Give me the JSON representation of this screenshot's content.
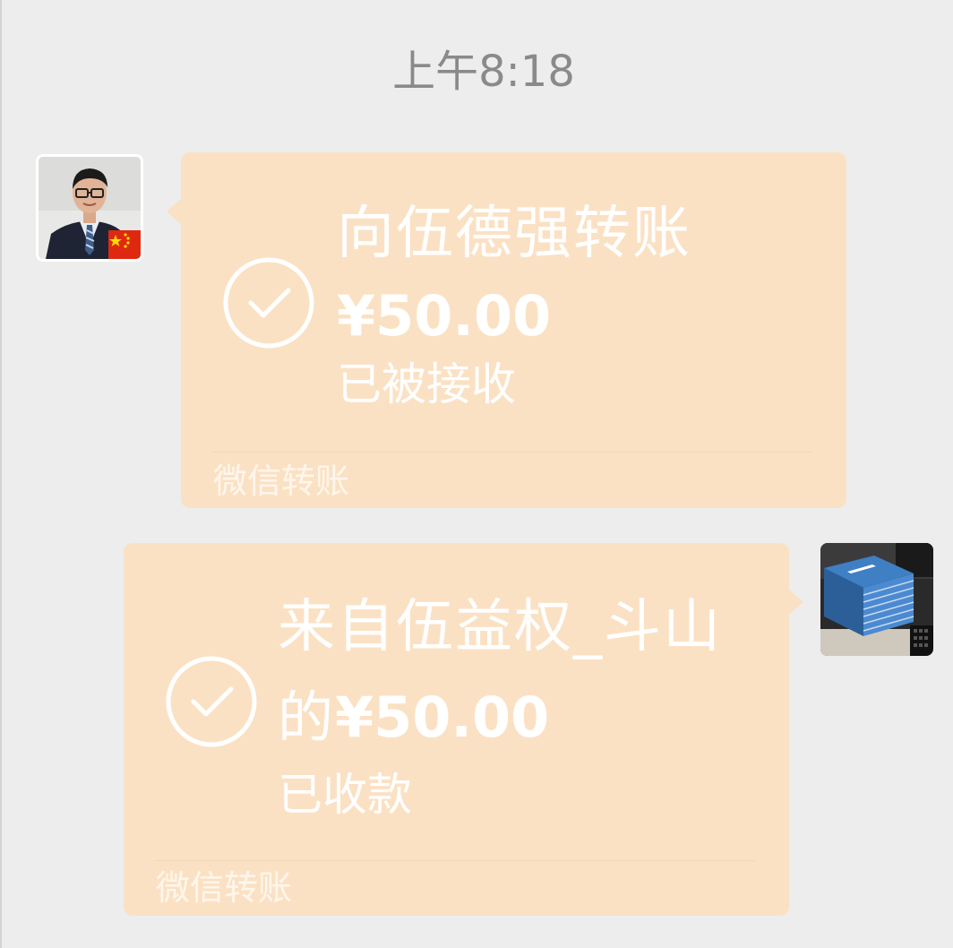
{
  "chat": {
    "timestamp": "上午8:18",
    "messages": [
      {
        "side": "left",
        "avatar_icon": "person-with-china-flag-avatar",
        "check_icon": "check-circle-icon",
        "title": "向伍德强转账",
        "amount": "¥50.00",
        "status": "已被接收",
        "footer": "微信转账"
      },
      {
        "side": "right",
        "avatar_icon": "stacked-books-avatar",
        "check_icon": "check-circle-icon",
        "title": "来自伍益权_斗山",
        "amount_prefix": "的",
        "amount": "¥50.00",
        "status": "已收款",
        "footer": "微信转账"
      }
    ]
  },
  "colors": {
    "background": "#ededed",
    "bubble": "#fbe1c4",
    "text": "#ffffff",
    "timestamp": "#8a8a8a"
  }
}
